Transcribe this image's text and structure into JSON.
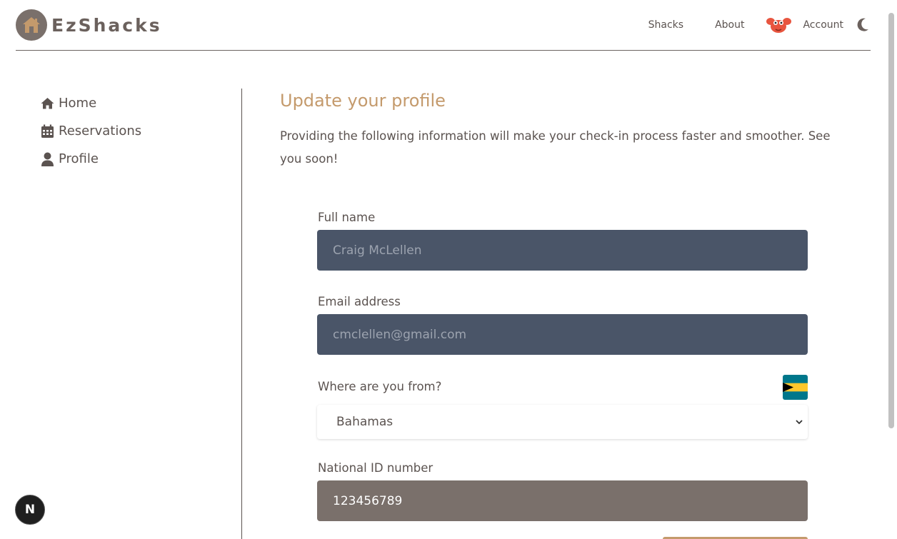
{
  "brand": {
    "name": "EzShacks"
  },
  "nav": {
    "shacks": "Shacks",
    "about": "About",
    "account": "Account"
  },
  "sidebar": {
    "items": [
      {
        "label": "Home",
        "icon": "home-icon"
      },
      {
        "label": "Reservations",
        "icon": "calendar-icon"
      },
      {
        "label": "Profile",
        "icon": "user-icon"
      }
    ]
  },
  "main": {
    "title": "Update your profile",
    "intro": "Providing the following information will make your check-in process faster and smoother. See you soon!"
  },
  "form": {
    "full_name_label": "Full name",
    "full_name_value": "Craig McLellen",
    "email_label": "Email address",
    "email_value": "cmclellen@gmail.com",
    "country_label": "Where are you from?",
    "country_value": "Bahamas",
    "national_id_label": "National ID number",
    "national_id_value": "123456789"
  },
  "badge": {
    "text": "N"
  },
  "colors": {
    "accent": "#c49a6c",
    "brand_gray": "#7a706b",
    "disabled_input": "#4a5568"
  }
}
